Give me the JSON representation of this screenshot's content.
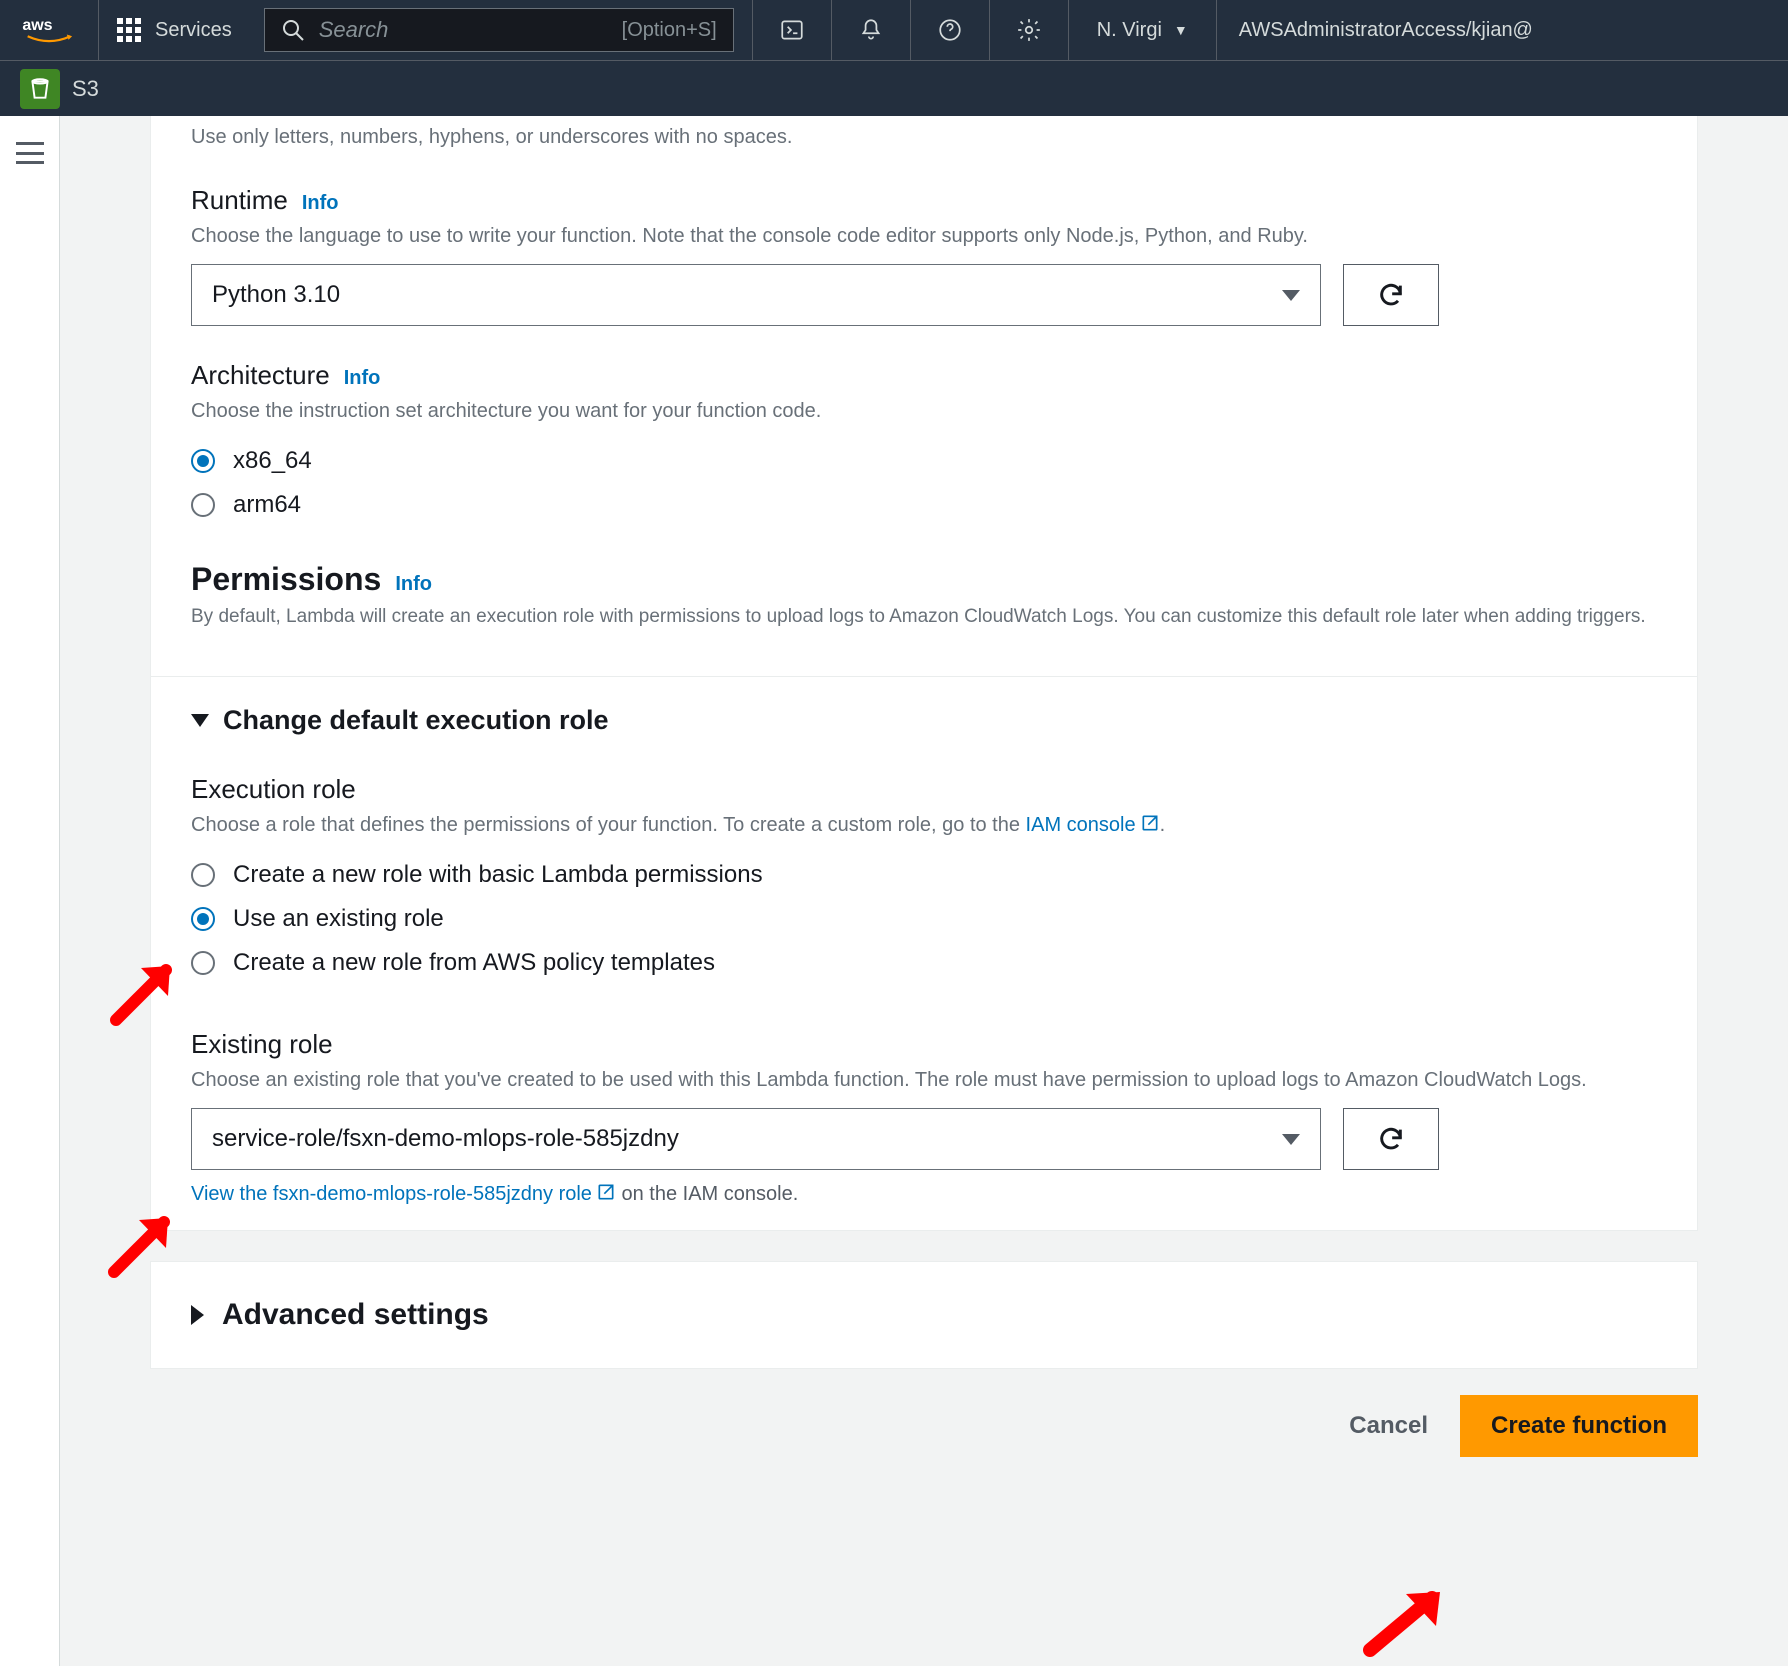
{
  "nav": {
    "services": "Services",
    "search_placeholder": "Search",
    "shortcut": "[Option+S]",
    "account": "N. Virgi",
    "role": "AWSAdministratorAccess/kjian@"
  },
  "subnav": {
    "label": "S3"
  },
  "nameHint": "Use only letters, numbers, hyphens, or underscores with no spaces.",
  "runtime": {
    "label": "Runtime",
    "info": "Info",
    "help": "Choose the language to use to write your function. Note that the console code editor supports only Node.js, Python, and Ruby.",
    "value": "Python 3.10"
  },
  "architecture": {
    "label": "Architecture",
    "info": "Info",
    "help": "Choose the instruction set architecture you want for your function code.",
    "options": [
      "x86_64",
      "arm64"
    ],
    "selected": "x86_64"
  },
  "permissions": {
    "label": "Permissions",
    "info": "Info",
    "desc": "By default, Lambda will create an execution role with permissions to upload logs to Amazon CloudWatch Logs. You can customize this default role later when adding triggers.",
    "expanderTitle": "Change default execution role",
    "execRole": {
      "label": "Execution role",
      "help_pre": "Choose a role that defines the permissions of your function. To create a custom role, go to the ",
      "help_link": "IAM console",
      "options": [
        "Create a new role with basic Lambda permissions",
        "Use an existing role",
        "Create a new role from AWS policy templates"
      ],
      "selected": "Use an existing role"
    },
    "existingRole": {
      "label": "Existing role",
      "help": "Choose an existing role that you've created to be used with this Lambda function. The role must have permission to upload logs to Amazon CloudWatch Logs.",
      "value": "service-role/fsxn-demo-mlops-role-585jzdny",
      "viewLinkText": "View the fsxn-demo-mlops-role-585jzdny role",
      "suffix": " on the IAM console."
    }
  },
  "advanced": {
    "title": "Advanced settings"
  },
  "buttons": {
    "cancel": "Cancel",
    "create": "Create function"
  }
}
